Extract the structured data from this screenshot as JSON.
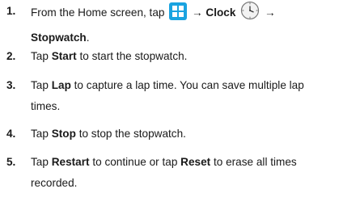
{
  "steps": [
    {
      "number": "1.",
      "text_before": "From the Home screen, tap",
      "arrow1": "→",
      "clock": "Clock",
      "arrow2": "→",
      "stopwatch": "Stopwatch",
      "end": ".",
      "icons": [
        "apps-grid-icon",
        "clock-icon"
      ],
      "colors": {
        "apps_icon": "#1aa3e0"
      }
    },
    {
      "number": "2.",
      "pre": "Tap",
      "bold": "Start",
      "post": "to start the stopwatch."
    },
    {
      "number": "3.",
      "pre": "Tap",
      "bold": "Lap",
      "post": "to capture a lap time. You can save multiple lap",
      "post2": "times."
    },
    {
      "number": "4.",
      "pre": "Tap",
      "bold": "Stop",
      "post": "to stop the stopwatch."
    },
    {
      "number": "5.",
      "pre": "Tap",
      "bold": "Restart",
      "mid": "to continue or tap",
      "bold2": "Reset",
      "post": "to erase all times",
      "post2": "recorded."
    }
  ]
}
